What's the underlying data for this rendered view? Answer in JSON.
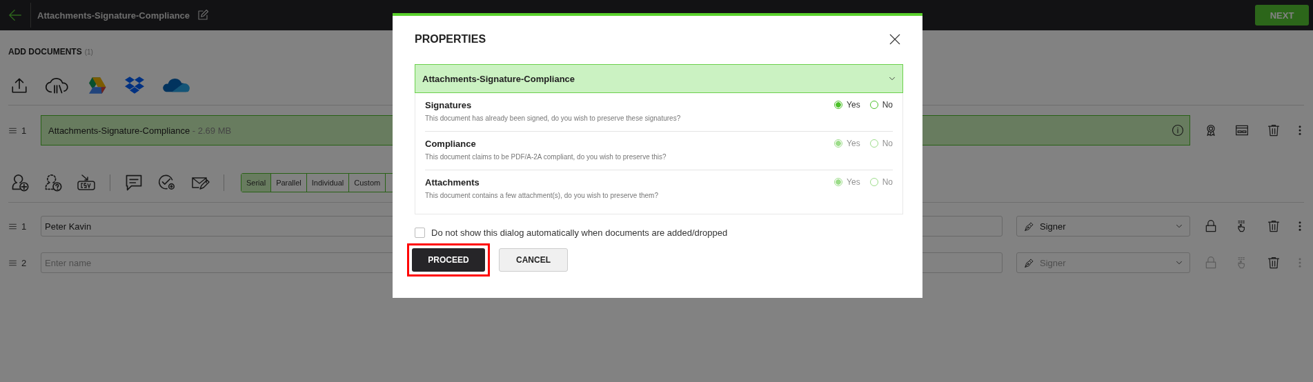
{
  "header": {
    "title": "Attachments-Signature-Compliance",
    "next_button": "NEXT"
  },
  "documents": {
    "heading": "ADD DOCUMENTS",
    "count": "(1)",
    "items": [
      {
        "number": "1",
        "name": "Attachments-Signature-Compliance",
        "size": "- 2.69 MB"
      }
    ]
  },
  "signing_order": [
    {
      "label": "Serial",
      "selected": true
    },
    {
      "label": "Parallel",
      "selected": false
    },
    {
      "label": "Individual",
      "selected": false
    },
    {
      "label": "Custom",
      "selected": false
    }
  ],
  "recipients": [
    {
      "number": "1",
      "name": "Peter Kavin",
      "role": "Signer",
      "disabled": false
    },
    {
      "number": "2",
      "placeholder": "Enter name",
      "role": "Signer",
      "disabled": true
    }
  ],
  "dialog": {
    "title": "PROPERTIES",
    "document": "Attachments-Signature-Compliance",
    "expanded": true,
    "options": [
      {
        "label": "Signatures",
        "description": "This document has already been signed, do you wish to preserve these signatures?",
        "disabled": false,
        "choices": [
          {
            "label": "Yes",
            "selected": true
          },
          {
            "label": "No",
            "selected": false
          }
        ]
      },
      {
        "label": "Compliance",
        "description": "This document claims to be PDF/A-2A compliant, do you wish to preserve this?",
        "disabled": true,
        "choices": [
          {
            "label": "Yes",
            "selected": true
          },
          {
            "label": "No",
            "selected": false
          }
        ]
      },
      {
        "label": "Attachments",
        "description": "This document contains a few attachment(s), do you wish to preserve them?",
        "disabled": true,
        "choices": [
          {
            "label": "Yes",
            "selected": true
          },
          {
            "label": "No",
            "selected": false
          }
        ]
      }
    ],
    "dont_show": {
      "label": "Do not show this dialog automatically when documents are added/dropped",
      "checked": false
    },
    "buttons": [
      {
        "label": "PROCEED",
        "kind": "primary",
        "highlighted": true
      },
      {
        "label": "CANCEL",
        "kind": "secondary",
        "highlighted": false
      }
    ]
  }
}
